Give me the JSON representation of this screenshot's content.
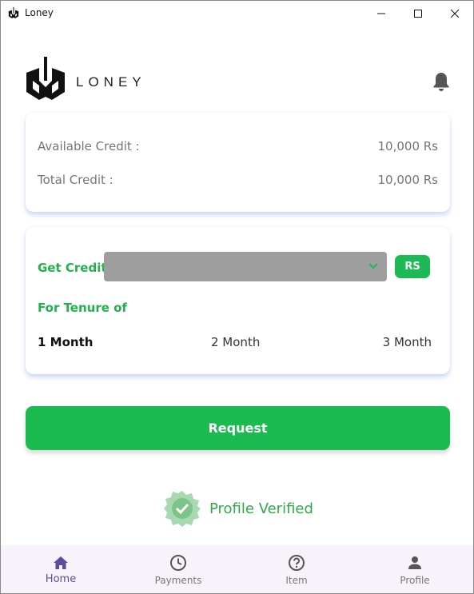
{
  "window": {
    "title": "Loney",
    "controls": [
      "minimize-icon",
      "maximize-icon",
      "close-icon"
    ]
  },
  "header": {
    "brand": "LONEY",
    "notification_icon": "bell-icon"
  },
  "credit_card": {
    "available_label": "Available Credit :",
    "available_value": "10,000 Rs",
    "total_label": "Total Credit :",
    "total_value": "10,000 Rs"
  },
  "get_credit": {
    "label": "Get Credit",
    "select_value": "",
    "currency_button": "RS",
    "tenure_label": "For Tenure of",
    "tenure_options": [
      "1 Month",
      "2 Month",
      "3 Month"
    ],
    "selected_tenure": "1 Month"
  },
  "request_button": "Request",
  "profile_status": "Profile Verified",
  "bottom_nav": {
    "items": [
      {
        "label": "Home",
        "icon": "home-icon",
        "active": true
      },
      {
        "label": "Payments",
        "icon": "clock-icon",
        "active": false
      },
      {
        "label": "Item",
        "icon": "help-circle-icon",
        "active": false
      },
      {
        "label": "Profile",
        "icon": "person-icon",
        "active": false
      }
    ]
  },
  "colors": {
    "accent_green": "#1bbb4f",
    "label_green": "#22b14c",
    "nav_active": "#5e4ca0",
    "select_gray": "#9e9e9e",
    "nav_background": "#f8f2fb"
  }
}
